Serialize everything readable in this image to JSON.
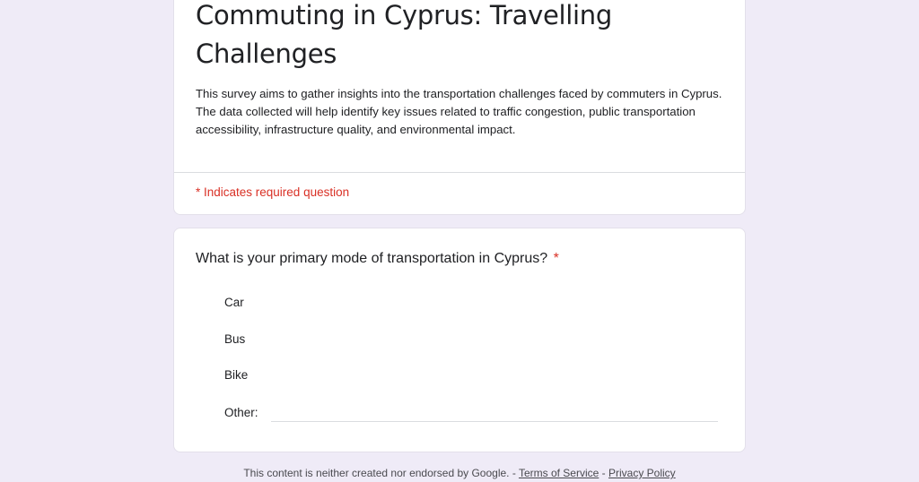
{
  "form": {
    "title": "Commuting in Cyprus: Travelling Challenges",
    "description": "This survey aims to gather insights into the transportation challenges faced by commuters in Cyprus. The data collected will help identify key issues related to traffic congestion, public transportation accessibility, infrastructure quality, and environmental impact.",
    "required_note": "* Indicates required question"
  },
  "question": {
    "title": "What is your primary mode of transportation in Cyprus?",
    "required_marker": "*",
    "options": [
      {
        "label": "Car"
      },
      {
        "label": "Bus"
      },
      {
        "label": "Bike"
      },
      {
        "label": "Other:"
      }
    ],
    "other_value": "",
    "other_placeholder": ""
  },
  "footer": {
    "text": "This content is neither created nor endorsed by Google.",
    "sep1": " - ",
    "terms_link": "Terms of Service",
    "sep2": " - ",
    "privacy_link": "Privacy Policy"
  },
  "colors": {
    "background": "#efebf7",
    "required_red": "#d93025",
    "card": "#ffffff"
  }
}
